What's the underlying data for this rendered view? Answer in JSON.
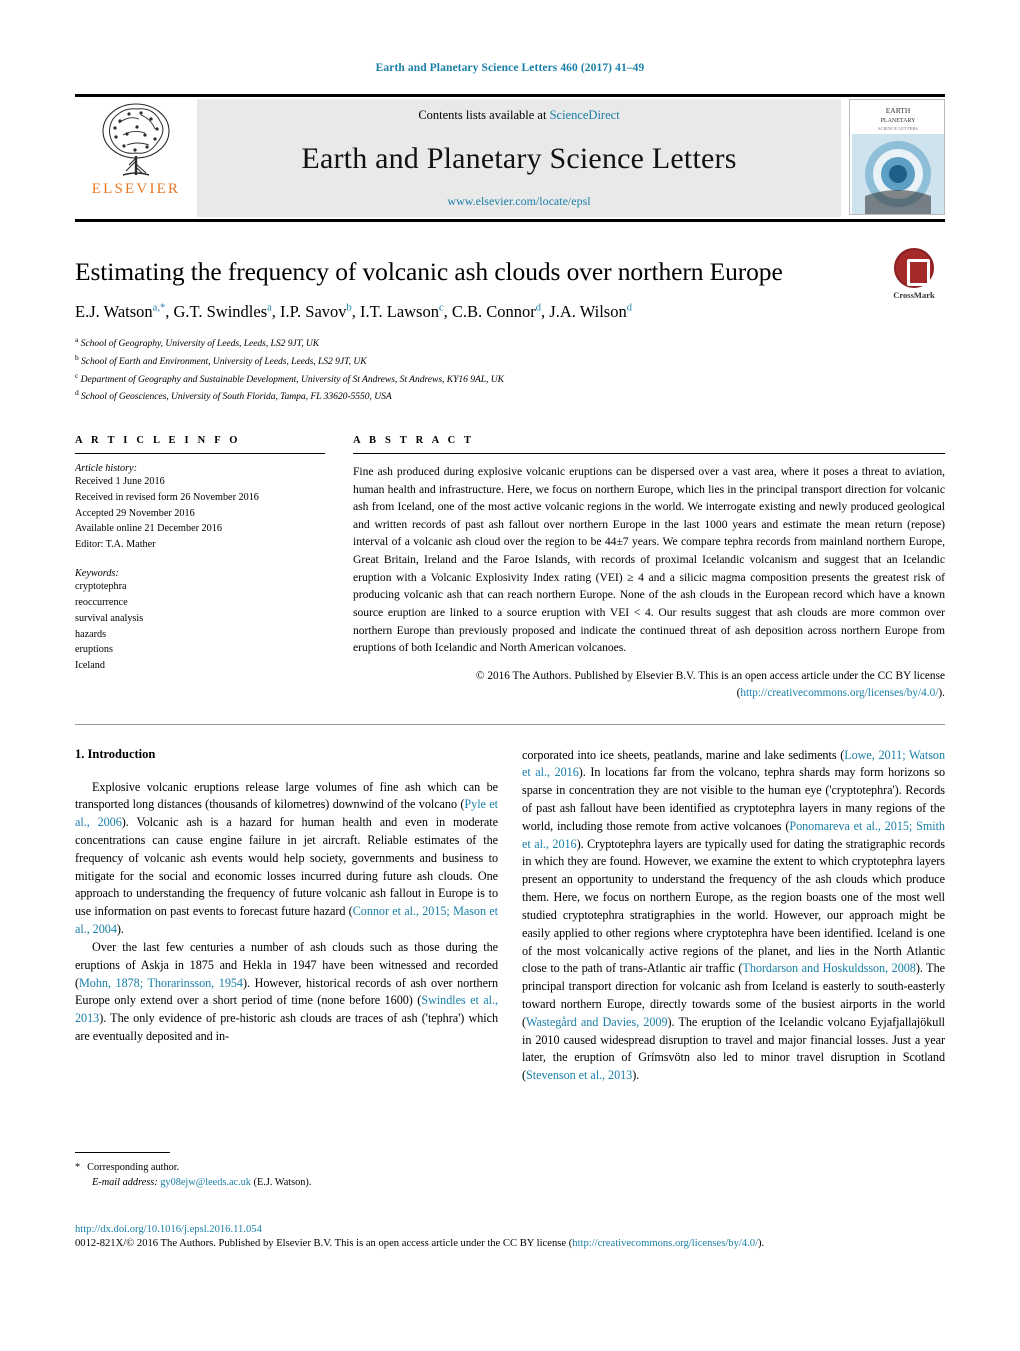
{
  "running_head": "Earth and Planetary Science Letters 460 (2017) 41–49",
  "masthead": {
    "contents_prefix": "Contents lists available at ",
    "sciencedirect": "ScienceDirect",
    "journal_name": "Earth and Planetary Science Letters",
    "journal_url": "www.elsevier.com/locate/epsl",
    "publisher_wordmark": "ELSEVIER",
    "cover_title_line1": "EARTH",
    "cover_title_line2": "PLANETARY",
    "cover_title_line3": "SCIENCE LETTERS"
  },
  "article": {
    "title": "Estimating the frequency of volcanic ash clouds over northern Europe",
    "crossmark_label": "CrossMark",
    "authors": [
      {
        "name": "E.J. Watson",
        "marks": "a,*"
      },
      {
        "name": "G.T. Swindles",
        "marks": "a"
      },
      {
        "name": "I.P. Savov",
        "marks": "b"
      },
      {
        "name": "I.T. Lawson",
        "marks": "c"
      },
      {
        "name": "C.B. Connor",
        "marks": "d"
      },
      {
        "name": "J.A. Wilson",
        "marks": "d"
      }
    ],
    "affiliations": [
      {
        "mark": "a",
        "text": "School of Geography, University of Leeds, Leeds, LS2 9JT, UK"
      },
      {
        "mark": "b",
        "text": "School of Earth and Environment, University of Leeds, Leeds, LS2 9JT, UK"
      },
      {
        "mark": "c",
        "text": "Department of Geography and Sustainable Development, University of St Andrews, St Andrews, KY16 9AL, UK"
      },
      {
        "mark": "d",
        "text": "School of Geosciences, University of South Florida, Tampa, FL 33620-5550, USA"
      }
    ]
  },
  "article_info": {
    "heading": "A R T I C L E   I N F O",
    "history_label": "Article history:",
    "history": [
      "Received 1 June 2016",
      "Received in revised form 26 November 2016",
      "Accepted 29 November 2016",
      "Available online 21 December 2016",
      "Editor: T.A. Mather"
    ],
    "keywords_label": "Keywords:",
    "keywords": [
      "cryptotephra",
      "reoccurrence",
      "survival analysis",
      "hazards",
      "eruptions",
      "Iceland"
    ]
  },
  "abstract": {
    "heading": "A B S T R A C T",
    "text": "Fine ash produced during explosive volcanic eruptions can be dispersed over a vast area, where it poses a threat to aviation, human health and infrastructure. Here, we focus on northern Europe, which lies in the principal transport direction for volcanic ash from Iceland, one of the most active volcanic regions in the world. We interrogate existing and newly produced geological and written records of past ash fallout over northern Europe in the last 1000 years and estimate the mean return (repose) interval of a volcanic ash cloud over the region to be 44±7 years. We compare tephra records from mainland northern Europe, Great Britain, Ireland and the Faroe Islands, with records of proximal Icelandic volcanism and suggest that an Icelandic eruption with a Volcanic Explosivity Index rating (VEI) ≥ 4 and a silicic magma composition presents the greatest risk of producing volcanic ash that can reach northern Europe. None of the ash clouds in the European record which have a known source eruption are linked to a source eruption with VEI < 4. Our results suggest that ash clouds are more common over northern Europe than previously proposed and indicate the continued threat of ash deposition across northern Europe from eruptions of both Icelandic and North American volcanoes.",
    "copyright_text": "© 2016 The Authors. Published by Elsevier B.V. This is an open access article under the CC BY license",
    "copyright_link_open": "(",
    "copyright_link": "http://creativecommons.org/licenses/by/4.0/",
    "copyright_link_close": ")."
  },
  "intro": {
    "heading": "1. Introduction",
    "left_paragraphs": [
      "Explosive volcanic eruptions release large volumes of fine ash which can be transported long distances (thousands of kilometres) downwind of the volcano (Pyle et al., 2006). Volcanic ash is a hazard for human health and even in moderate concentrations can cause engine failure in jet aircraft. Reliable estimates of the frequency of volcanic ash events would help society, governments and business to mitigate for the social and economic losses incurred during future ash clouds. One approach to understanding the frequency of future volcanic ash fallout in Europe is to use information on past events to forecast future hazard (Connor et al., 2015; Mason et al., 2004).",
      "Over the last few centuries a number of ash clouds such as those during the eruptions of Askja in 1875 and Hekla in 1947 have been witnessed and recorded (Mohn, 1878; Thorarinsson, 1954). However, historical records of ash over northern Europe only extend over a short period of time (none before 1600) (Swindles et al., 2013). The only evidence of pre-historic ash clouds are traces of ash ('tephra') which are eventually deposited and in-"
    ],
    "right_paragraphs": [
      "corporated into ice sheets, peatlands, marine and lake sediments (Lowe, 2011; Watson et al., 2016). In locations far from the volcano, tephra shards may form horizons so sparse in concentration they are not visible to the human eye ('cryptotephra'). Records of past ash fallout have been identified as cryptotephra layers in many regions of the world, including those remote from active volcanoes (Ponomareva et al., 2015; Smith et al., 2016). Cryptotephra layers are typically used for dating the stratigraphic records in which they are found. However, we examine the extent to which cryptotephra layers present an opportunity to understand the frequency of the ash clouds which produce them. Here, we focus on northern Europe, as the region boasts one of the most well studied cryptotephra stratigraphies in the world. However, our approach might be easily applied to other regions where cryptotephra have been identified. Iceland is one of the most volcanically active regions of the planet, and lies in the North Atlantic close to the path of trans-Atlantic air traffic (Thordarson and Hoskuldsson, 2008). The principal transport direction for volcanic ash from Iceland is easterly to south-easterly toward northern Europe, directly towards some of the busiest airports in the world (Wastegård and Davies, 2009). The eruption of the Icelandic volcano Eyjafjallajökull in 2010 caused widespread disruption to travel and major financial losses. Just a year later, the eruption of Grímsvötn also led to minor travel disruption in Scotland (Stevenson et al., 2013)."
    ]
  },
  "footnote": {
    "star": "*",
    "corresponding": "Corresponding author.",
    "email_label": "E-mail address:",
    "email": "gy08ejw@leeds.ac.uk",
    "email_owner": "(E.J. Watson)."
  },
  "footer": {
    "doi": "http://dx.doi.org/10.1016/j.epsl.2016.11.054",
    "issn_line_pre": "0012-821X/",
    "issn_line": "© 2016 The Authors. Published by Elsevier B.V. This is an open access article under the CC BY license (",
    "issn_link": "http://creativecommons.org/licenses/by/4.0/",
    "issn_line_post": ")."
  },
  "colors": {
    "link": "#1a7fa8",
    "elsevier_orange": "#E87722",
    "masthead_bg": "#e9e9e9",
    "crossmark_red": "#a52a2a"
  }
}
